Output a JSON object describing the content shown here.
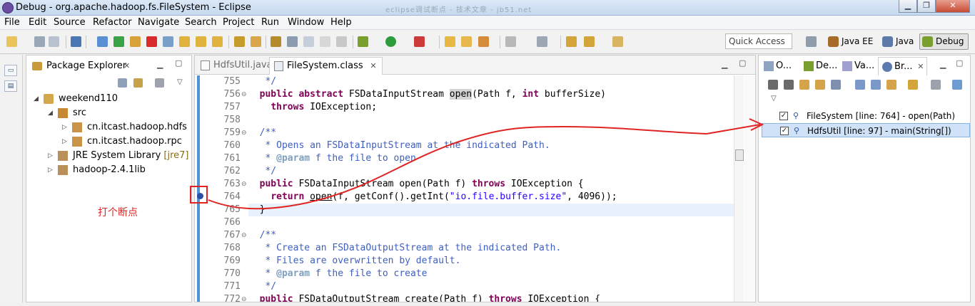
{
  "window": {
    "title": "Debug - org.apache.hadoop.fs.FileSystem - Eclipse",
    "faint_overlay": "eclipse调试断点 - 技术文章 - jb51.net"
  },
  "menu": [
    "File",
    "Edit",
    "Source",
    "Refactor",
    "Navigate",
    "Search",
    "Project",
    "Run",
    "Window",
    "Help"
  ],
  "toolbar": {
    "quick_access": "Quick Access",
    "perspectives": [
      "Java EE",
      "Java",
      "Debug"
    ]
  },
  "package_explorer": {
    "title": "Package Explorer",
    "tree": [
      {
        "label": "weekend110",
        "decoration": ""
      },
      {
        "label": "src",
        "decoration": ""
      },
      {
        "label": "cn.itcast.hadoop.hdfs",
        "decoration": ""
      },
      {
        "label": "cn.itcast.hadoop.rpc",
        "decoration": ""
      },
      {
        "label": "JRE System Library",
        "decoration": "[jre7]"
      },
      {
        "label": "hadoop-2.4.1lib",
        "decoration": ""
      }
    ]
  },
  "annotation": {
    "note": "打个断点"
  },
  "editor": {
    "tabs": [
      "HdfsUtil.java",
      "FileSystem.class"
    ],
    "lines": [
      {
        "num": "755",
        "fold": "",
        "text": "   */"
      },
      {
        "num": "756",
        "fold": "⊖",
        "text": "  public abstract FSDataInputStream open(Path f, int bufferSize)"
      },
      {
        "num": "757",
        "fold": "",
        "text": "    throws IOException;"
      },
      {
        "num": "758",
        "fold": "",
        "text": ""
      },
      {
        "num": "759",
        "fold": "⊖",
        "text": "  /**"
      },
      {
        "num": "760",
        "fold": "",
        "text": "   * Opens an FSDataInputStream at the indicated Path."
      },
      {
        "num": "761",
        "fold": "",
        "text": "   * @param f the file to open"
      },
      {
        "num": "762",
        "fold": "",
        "text": "   */"
      },
      {
        "num": "763",
        "fold": "⊖",
        "text": "  public FSDataInputStream open(Path f) throws IOException {"
      },
      {
        "num": "764",
        "fold": "",
        "text": "    return open(f, getConf().getInt(\"io.file.buffer.size\", 4096));"
      },
      {
        "num": "765",
        "fold": "",
        "text": "  }"
      },
      {
        "num": "766",
        "fold": "",
        "text": ""
      },
      {
        "num": "767",
        "fold": "⊖",
        "text": "  /**"
      },
      {
        "num": "768",
        "fold": "",
        "text": "   * Create an FSDataOutputStream at the indicated Path."
      },
      {
        "num": "769",
        "fold": "",
        "text": "   * Files are overwritten by default."
      },
      {
        "num": "770",
        "fold": "",
        "text": "   * @param f the file to create"
      },
      {
        "num": "771",
        "fold": "",
        "text": "   */"
      },
      {
        "num": "772",
        "fold": "⊖",
        "text": "  public FSDataOutputStream create(Path f) throws IOException {"
      }
    ]
  },
  "breakpoints_view": {
    "tabs": [
      "O...",
      "De...",
      "Va...",
      "Br..."
    ],
    "items": [
      {
        "label": "FileSystem [line: 764] - open(Path)",
        "checked": true
      },
      {
        "label": "HdfsUtil [line: 97] - main(String[])",
        "checked": true
      }
    ]
  },
  "colors": {
    "keyword": "#7f0055",
    "comment": "#3f5fbf",
    "string": "#2a00ff",
    "annotation_red": "#e02424",
    "selection": "#cfe2f7"
  }
}
